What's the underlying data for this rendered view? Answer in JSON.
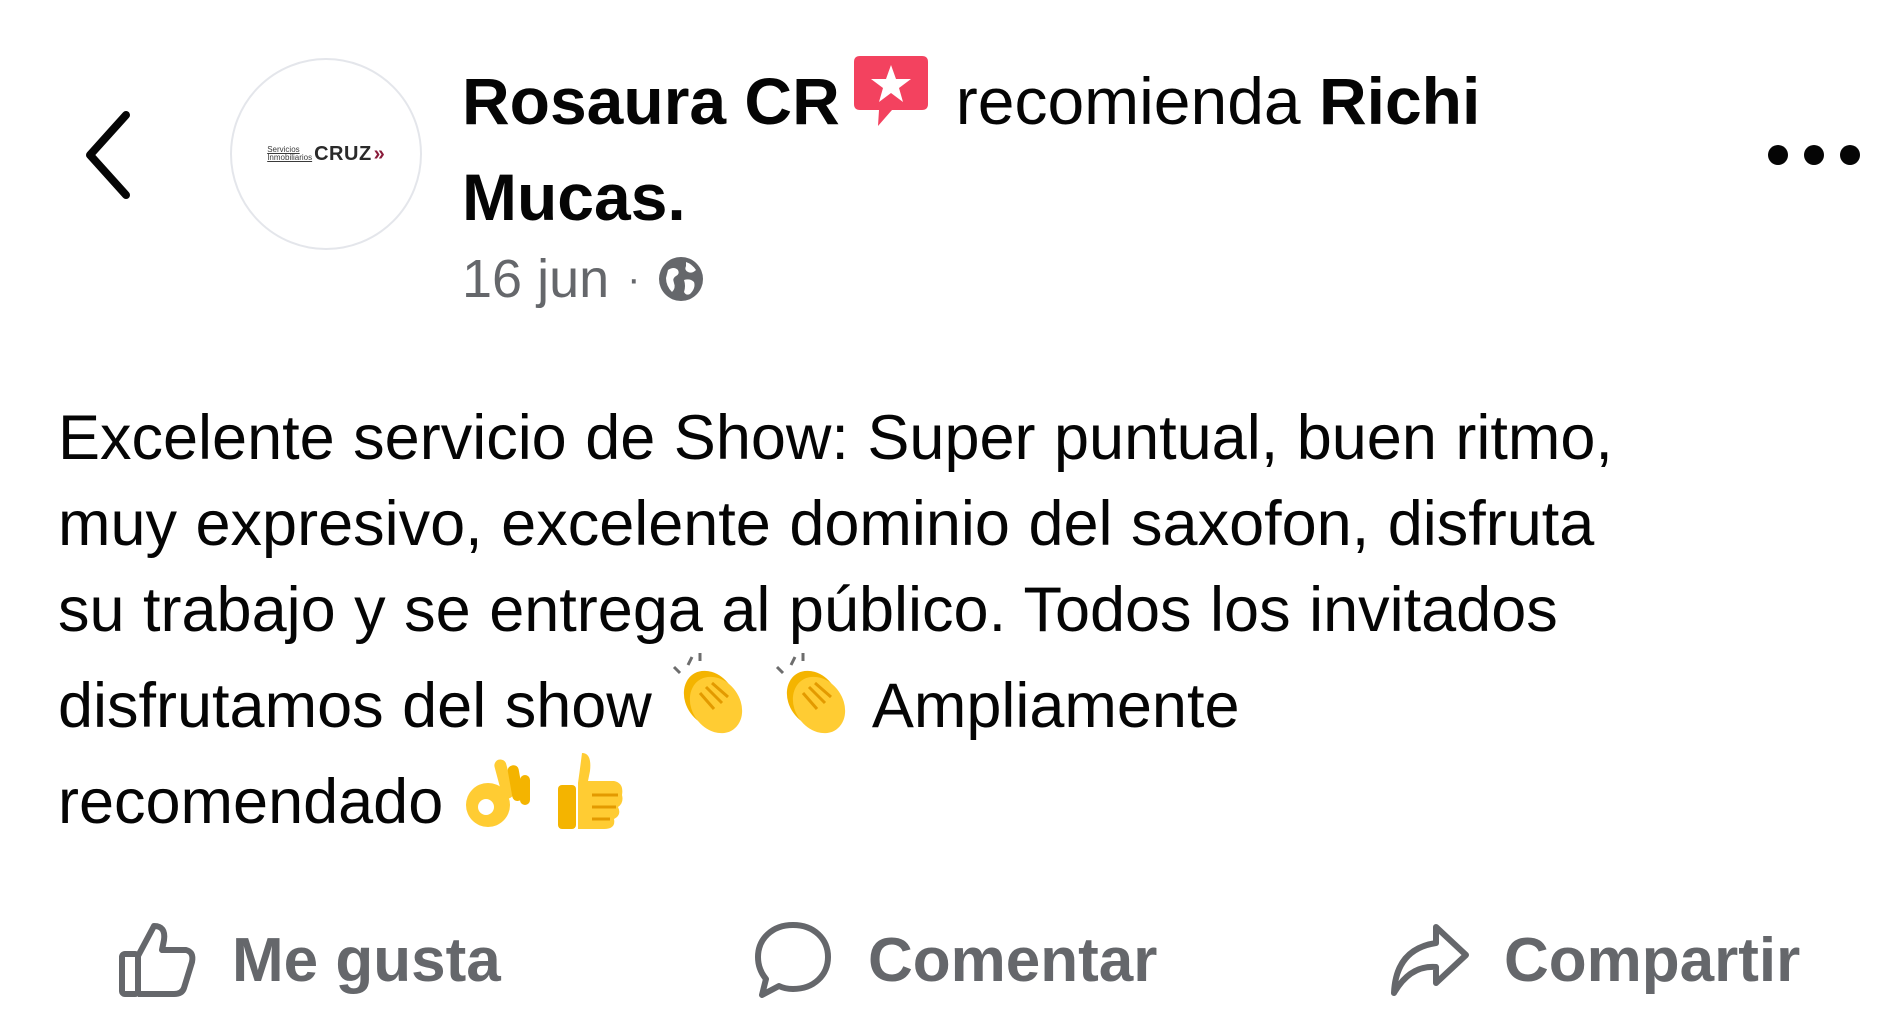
{
  "header": {
    "back_icon": "chevron-left-icon",
    "avatar_logo": {
      "small_line1": "Servicios",
      "small_line2": "Inmobiliarios",
      "big": "CRUZ",
      "chevron": "»"
    },
    "author": "Rosaura CR",
    "recommend_icon": "recommendation-star-icon",
    "verb": "recomienda",
    "target": "Richi Mucas.",
    "date": "16 jun",
    "separator": "·",
    "privacy_icon": "globe-icon",
    "more_icon": "more-horizontal-icon"
  },
  "post": {
    "text_line1": "Excelente servicio de Show: Super puntual, buen ritmo,",
    "text_line2": "muy expresivo, excelente dominio del saxofon, disfruta",
    "text_line3": "su trabajo y se entrega al público. Todos los invitados",
    "text_line4_a": "disfrutamos del show",
    "text_line4_b": "Ampliamente",
    "text_line5": "recomendado",
    "emojis": [
      "clapping-hands",
      "clapping-hands",
      "ok-hand",
      "thumbs-up"
    ]
  },
  "actions": {
    "like_label": "Me gusta",
    "comment_label": "Comentar",
    "share_label": "Compartir"
  },
  "colors": {
    "text": "#050505",
    "secondary": "#65676b",
    "recommend_badge": "#f3425f",
    "logo_accent": "#8a1b3a",
    "emoji_yellow": "#ffcc33"
  }
}
